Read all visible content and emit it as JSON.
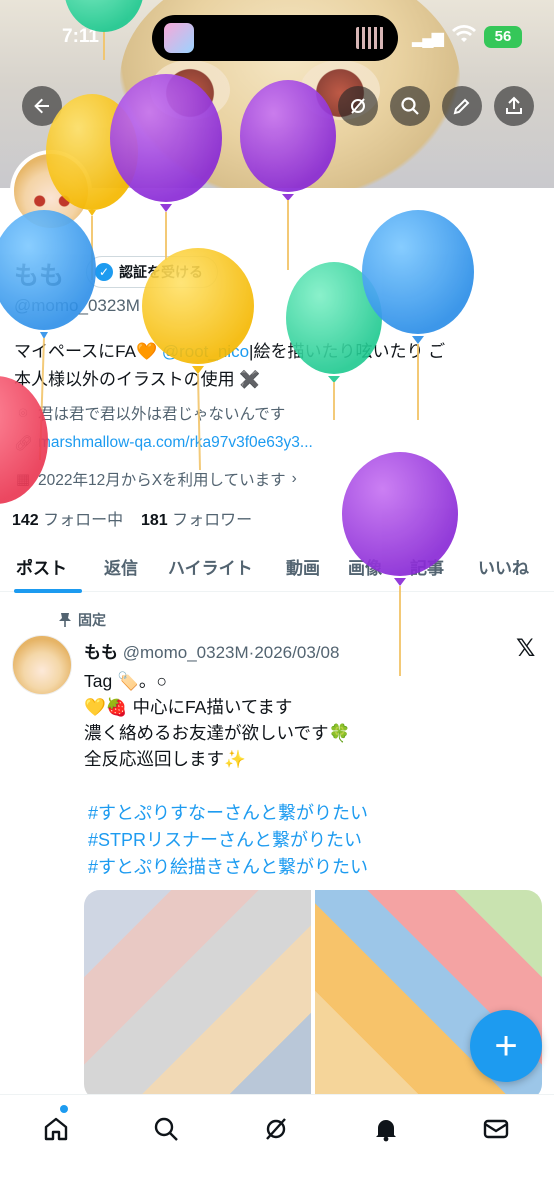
{
  "status": {
    "time": "7:11",
    "battery": "56"
  },
  "profile": {
    "name": "もも",
    "verify_label": "認証を受ける",
    "handle": "@momo_0323M",
    "bio_line1_pre": "マイペースにFA",
    "bio_heart": "🧡",
    "bio_mention": "@root_nico",
    "bio_line1_post": "|絵を描いたり呟いたり ご",
    "bio_line2": "本人様以外のイラストの使用 ✖️",
    "location": "君は君で君以外は君じゃないんです",
    "link": "marshmallow-qa.com/rka97v3f0e63y3...",
    "joined": "2022年12月からXを利用しています",
    "following_count": "142",
    "following_label": "フォロー中",
    "followers_count": "181",
    "followers_label": "フォロワー"
  },
  "tabs": [
    "ポスト",
    "返信",
    "ハイライト",
    "動画",
    "画像",
    "記事",
    "いいね"
  ],
  "post": {
    "pinned_label": "固定",
    "author": "もも",
    "handle_date": "@momo_0323M·2026/03/08",
    "line1": "Tag 🏷️。○",
    "line2": "💛🍓 中心にFA描いてます",
    "line3": "濃く絡めるお友達が欲しいです🍀",
    "line4": "全反応巡回します✨",
    "tag1": "#すとぷりすなーさんと繋がりたい",
    "tag2": "#STPRリスナーさんと繋がりたい",
    "tag3": "#すとぷり絵描きさんと繋がりたい"
  },
  "icons": {
    "back": "back-arrow-icon",
    "grok": "grok-icon",
    "search": "search-icon",
    "edit": "pencil-icon",
    "share": "share-icon",
    "home": "home-icon",
    "explore": "search-icon",
    "notifications": "bell-icon",
    "messages": "mail-icon"
  },
  "colors": {
    "accent": "#1d9bf0",
    "text": "#0f1419",
    "muted": "#536471"
  }
}
